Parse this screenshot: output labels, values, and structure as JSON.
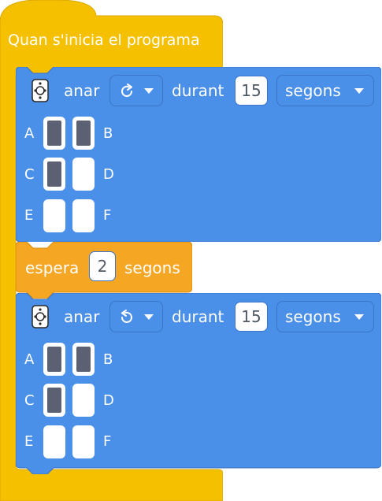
{
  "colors": {
    "event": "#f5c000",
    "motion": "#4a8fe8",
    "control": "#f5a623"
  },
  "event": {
    "label": "Quan s'inicia el programa"
  },
  "blocks": [
    {
      "icon": "motor-pair-icon",
      "go_label": "anar",
      "direction_icon": "rotate-clockwise-icon",
      "during_label": "durant",
      "duration": "15",
      "unit": "segons",
      "ports": [
        {
          "label": "A",
          "active": true
        },
        {
          "label": "B",
          "active": true
        },
        {
          "label": "C",
          "active": true
        },
        {
          "label": "D",
          "active": false
        },
        {
          "label": "E",
          "active": false
        },
        {
          "label": "F",
          "active": false
        }
      ]
    },
    {
      "icon": "motor-pair-icon",
      "go_label": "anar",
      "direction_icon": "rotate-counterclockwise-icon",
      "during_label": "durant",
      "duration": "15",
      "unit": "segons",
      "ports": [
        {
          "label": "A",
          "active": true
        },
        {
          "label": "B",
          "active": true
        },
        {
          "label": "C",
          "active": true
        },
        {
          "label": "D",
          "active": false
        },
        {
          "label": "E",
          "active": false
        },
        {
          "label": "F",
          "active": false
        }
      ]
    }
  ],
  "wait": {
    "label": "espera",
    "value": "2",
    "unit": "segons"
  }
}
